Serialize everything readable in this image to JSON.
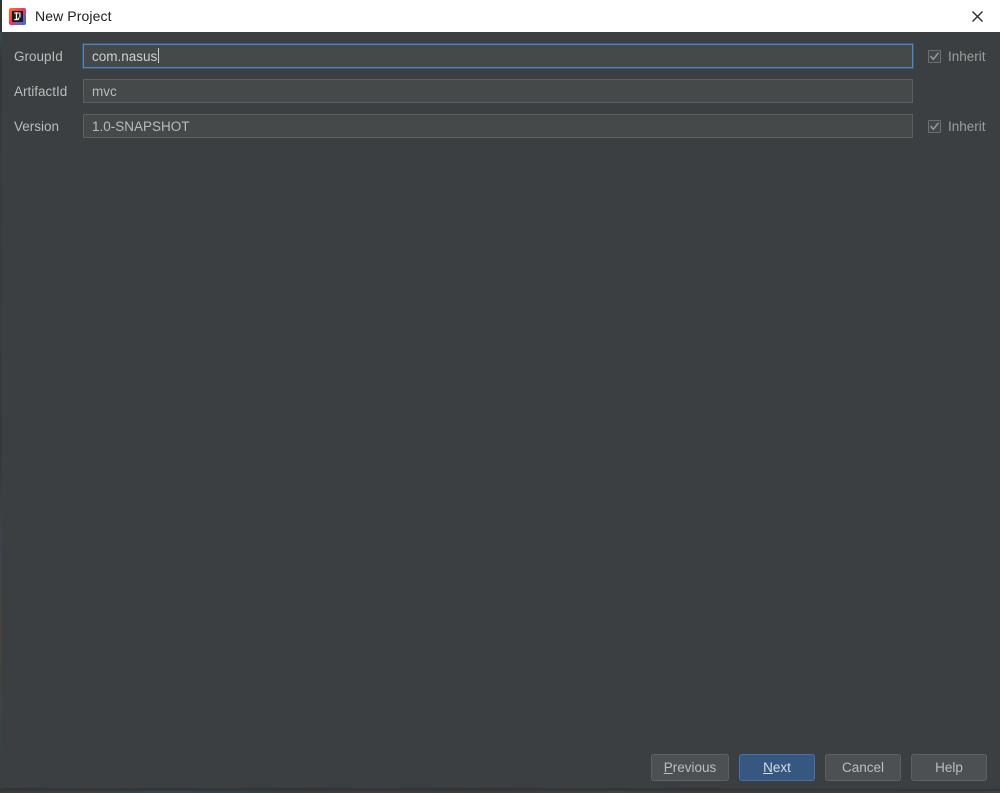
{
  "window": {
    "title": "New Project",
    "app_icon": "intellij-idea-icon",
    "close_icon": "close-icon",
    "background_color": "#3c3f41",
    "titlebar_color": "#ffffff"
  },
  "form": {
    "fields": [
      {
        "id": "groupid",
        "label": "GroupId",
        "value": "com.nasus",
        "placeholder": "",
        "focused": true,
        "has_inherit": true
      },
      {
        "id": "artifactid",
        "label": "ArtifactId",
        "value": "mvc",
        "placeholder": "",
        "focused": false,
        "has_inherit": false
      },
      {
        "id": "version",
        "label": "Version",
        "value": "1.0-SNAPSHOT",
        "placeholder": "",
        "focused": false,
        "has_inherit": true
      }
    ],
    "inherit": {
      "label": "Inherit",
      "checked": true,
      "enabled": false,
      "icon": "checkmark-icon"
    }
  },
  "buttons": {
    "previous": {
      "label": "Previous",
      "mnemonic": "P",
      "prefix": "",
      "suffix": "revious",
      "default": false
    },
    "next": {
      "label": "Next",
      "mnemonic": "N",
      "prefix": "",
      "suffix": "ext",
      "default": true
    },
    "cancel": {
      "label": "Cancel",
      "mnemonic": "",
      "prefix": "Cancel",
      "suffix": "",
      "default": false
    },
    "help": {
      "label": "Help",
      "mnemonic": "",
      "prefix": "Help",
      "suffix": "",
      "default": false
    }
  },
  "colors": {
    "accent_focus": "#4a88c7",
    "default_button": "#365880",
    "panel": "#3c3f41",
    "field": "#45494a",
    "text": "#bbbbbb"
  }
}
